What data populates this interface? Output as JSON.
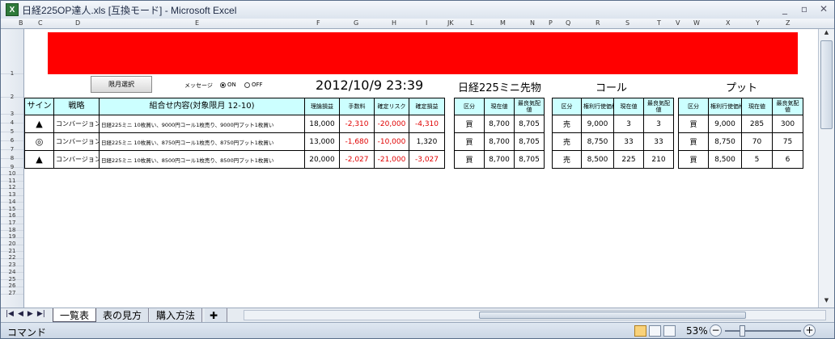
{
  "window": {
    "title": "日経225OP達人.xls  [互換モード] - Microsoft Excel",
    "app_icon": "X"
  },
  "columns": [
    "B",
    "C",
    "D",
    "E",
    "F",
    "G",
    "H",
    "I",
    "JK",
    "L",
    "M",
    "N",
    "P",
    "Q",
    "R",
    "S",
    "T",
    "V",
    "W",
    "X",
    "Y",
    "Z"
  ],
  "rows": [
    "1",
    "2",
    "3",
    "4",
    "5",
    "6",
    "7",
    "8",
    "9",
    "10",
    "11",
    "12",
    "13",
    "14",
    "15",
    "16",
    "17",
    "18",
    "19",
    "20",
    "21",
    "22",
    "23",
    "24",
    "25",
    "26",
    "27"
  ],
  "controls": {
    "month_button": "限月選択",
    "message_label": "メッセージ",
    "radio_on": "ON",
    "radio_off": "OFF",
    "datetime": "2012/10/9 23:39",
    "futures_label": "日経225ミニ先物",
    "call_label": "コール",
    "put_label": "プット"
  },
  "main_table": {
    "headers": [
      "サイン",
      "戦略",
      "組合せ内容(対象限月 12-10)",
      "理論損益",
      "手数料",
      "確定リスク",
      "確定損益"
    ],
    "rows": [
      {
        "sign": "▲",
        "strategy": "コンバージョン",
        "combo": "日経225ミニ 10枚買い、9000円コール1枚売り、9000円プット1枚買い",
        "theory": "18,000",
        "fee": "-2,310",
        "risk": "-20,000",
        "profit": "-4,310"
      },
      {
        "sign": "◎",
        "strategy": "コンバージョン",
        "combo": "日経225ミニ 10枚買い、8750円コール1枚売り、8750円プット1枚買い",
        "theory": "13,000",
        "fee": "-1,680",
        "risk": "-10,000",
        "profit": "1,320"
      },
      {
        "sign": "▲",
        "strategy": "コンバージョン",
        "combo": "日経225ミニ 10枚買い、8500円コール1枚売り、8500円プット1枚買い",
        "theory": "20,000",
        "fee": "-2,027",
        "risk": "-21,000",
        "profit": "-3,027"
      }
    ]
  },
  "futures_table": {
    "headers": [
      "区分",
      "現在値",
      "最良気配値"
    ],
    "rows": [
      [
        "買",
        "8,700",
        "8,705"
      ],
      [
        "買",
        "8,700",
        "8,705"
      ],
      [
        "買",
        "8,700",
        "8,705"
      ]
    ]
  },
  "call_table": {
    "headers": [
      "区分",
      "権利行使価格",
      "現在値",
      "最良気配値"
    ],
    "rows": [
      [
        "売",
        "9,000",
        "3",
        "3"
      ],
      [
        "売",
        "8,750",
        "33",
        "33"
      ],
      [
        "売",
        "8,500",
        "225",
        "210"
      ]
    ]
  },
  "put_table": {
    "headers": [
      "区分",
      "権利行使価格",
      "現在値",
      "最良気配値"
    ],
    "rows": [
      [
        "買",
        "9,000",
        "285",
        "300"
      ],
      [
        "買",
        "8,750",
        "70",
        "75"
      ],
      [
        "買",
        "8,500",
        "5",
        "6"
      ]
    ]
  },
  "tabs": [
    "一覧表",
    "表の見方",
    "購入方法"
  ],
  "status": {
    "mode": "コマンド",
    "zoom": "53%"
  }
}
